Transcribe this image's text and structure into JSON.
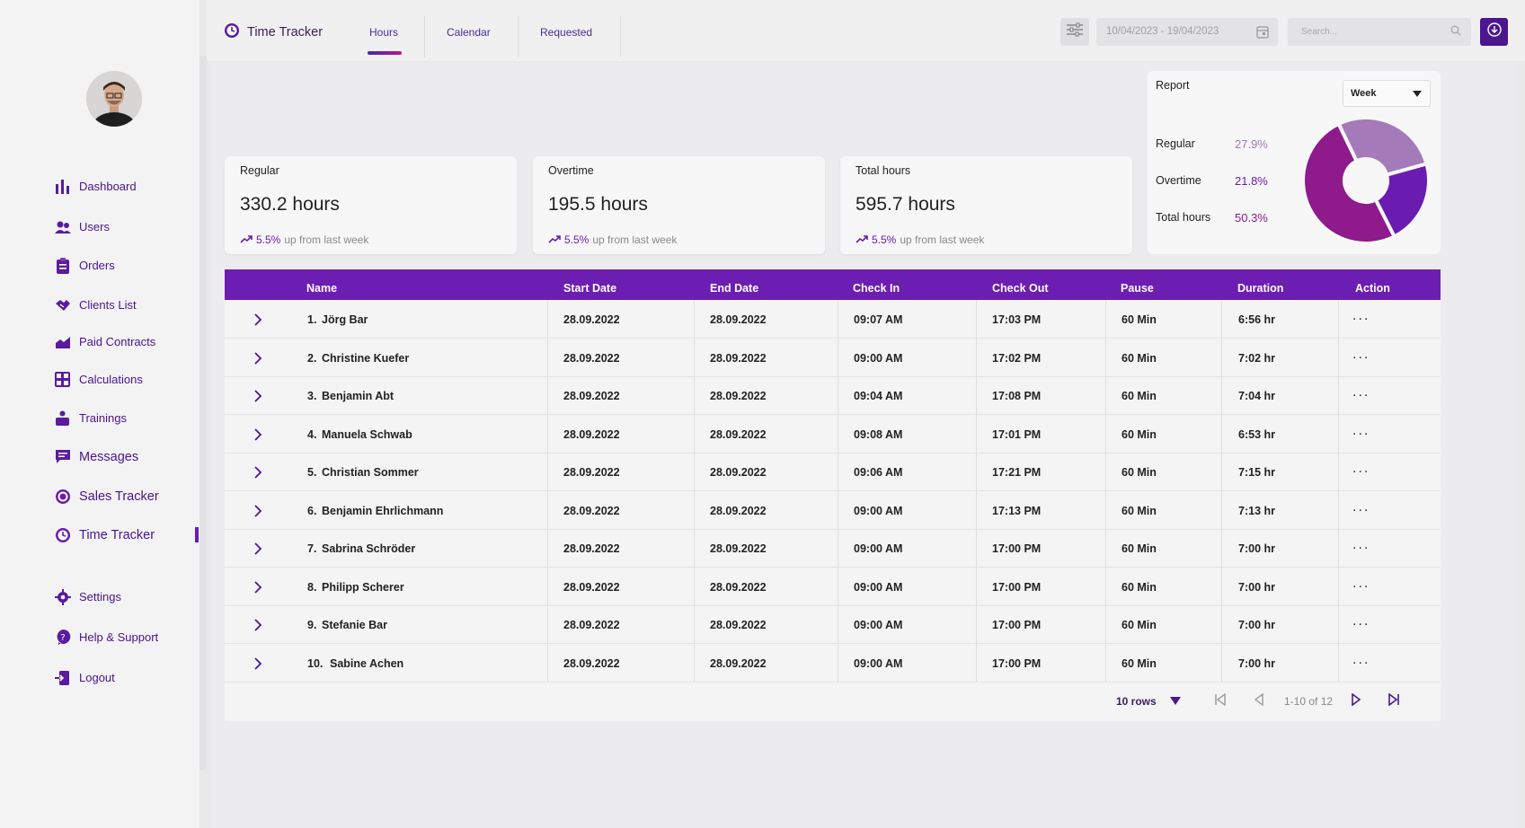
{
  "sidebar": {
    "items": [
      {
        "label": "Dashboard",
        "icon": "bar-chart-icon"
      },
      {
        "label": "Users",
        "icon": "users-icon"
      },
      {
        "label": "Orders",
        "icon": "clipboard-icon"
      },
      {
        "label": "Clients List",
        "icon": "handshake-icon"
      },
      {
        "label": "Paid Contracts",
        "icon": "growth-chart-icon"
      },
      {
        "label": "Calculations",
        "icon": "calculator-icon"
      },
      {
        "label": "Trainings",
        "icon": "trainings-icon"
      },
      {
        "label": "Messages",
        "icon": "message-icon"
      },
      {
        "label": "Sales Tracker",
        "icon": "target-icon"
      },
      {
        "label": "Time Tracker",
        "icon": "clock-icon"
      }
    ],
    "bottom": [
      {
        "label": "Settings",
        "icon": "gear-icon"
      },
      {
        "label": "Help & Support",
        "icon": "help-icon"
      },
      {
        "label": "Logout",
        "icon": "logout-icon"
      }
    ],
    "active": "Time Tracker"
  },
  "header": {
    "title": "Time Tracker",
    "tabs": [
      "Hours",
      "Calendar",
      "Requested"
    ],
    "active_tab": "Hours",
    "date_range": "10/04/2023 - 19/04/2023",
    "search_placeholder": "Search..."
  },
  "cards": [
    {
      "label": "Regular",
      "value": "330.2 hours",
      "trend_pct": "5.5%",
      "trend_text": "up from last week"
    },
    {
      "label": "Overtime",
      "value": "195.5 hours",
      "trend_pct": "5.5%",
      "trend_text": "up from last week"
    },
    {
      "label": "Total hours",
      "value": "595.7 hours",
      "trend_pct": "5.5%",
      "trend_text": "up from last week"
    }
  ],
  "report": {
    "title": "Report",
    "period": "Week",
    "legend": [
      {
        "label": "Regular",
        "value": "27.9%",
        "color": "#a57ab8"
      },
      {
        "label": "Overtime",
        "value": "21.8%",
        "color": "#6a1bb0"
      },
      {
        "label": "Total hours",
        "value": "50.3%",
        "color": "#8e1a8c"
      }
    ]
  },
  "chart_data": {
    "type": "pie",
    "categories": [
      "Regular",
      "Overtime",
      "Total hours"
    ],
    "values": [
      27.9,
      21.8,
      50.3
    ],
    "colors": [
      "#a57ab8",
      "#6a1bb0",
      "#8e1a8c"
    ]
  },
  "table": {
    "columns": [
      "Name",
      "Start Date",
      "End Date",
      "Check In",
      "Check Out",
      "Pause",
      "Duration",
      "Action"
    ],
    "rows": [
      {
        "num": "1.",
        "name": "Jörg Bar",
        "start": "28.09.2022",
        "end": "28.09.2022",
        "in": "09:07 AM",
        "out": "17:03 PM",
        "pause": "60 Min",
        "duration": "6:56 hr",
        "action": "..."
      },
      {
        "num": "2.",
        "name": "Christine Kuefer",
        "start": "28.09.2022",
        "end": "28.09.2022",
        "in": "09:00 AM",
        "out": "17:02 PM",
        "pause": "60 Min",
        "duration": "7:02 hr",
        "action": "..."
      },
      {
        "num": "3.",
        "name": "Benjamin Abt",
        "start": "28.09.2022",
        "end": "28.09.2022",
        "in": "09:04 AM",
        "out": "17:08 PM",
        "pause": "60 Min",
        "duration": "7:04 hr",
        "action": "..."
      },
      {
        "num": "4.",
        "name": "Manuela Schwab",
        "start": "28.09.2022",
        "end": "28.09.2022",
        "in": "09:08 AM",
        "out": "17:01 PM",
        "pause": "60 Min",
        "duration": "6:53 hr",
        "action": "..."
      },
      {
        "num": "5.",
        "name": "Christian Sommer",
        "start": "28.09.2022",
        "end": "28.09.2022",
        "in": "09:06 AM",
        "out": "17:21 PM",
        "pause": "60 Min",
        "duration": "7:15 hr",
        "action": "..."
      },
      {
        "num": "6.",
        "name": "Benjamin Ehrlichmann",
        "start": "28.09.2022",
        "end": "28.09.2022",
        "in": "09:00 AM",
        "out": "17:13 PM",
        "pause": "60 Min",
        "duration": "7:13 hr",
        "action": "..."
      },
      {
        "num": "7.",
        "name": "Sabrina Schröder",
        "start": "28.09.2022",
        "end": "28.09.2022",
        "in": "09:00 AM",
        "out": "17:00 PM",
        "pause": "60 Min",
        "duration": "7:00 hr",
        "action": "..."
      },
      {
        "num": "8.",
        "name": "Philipp Scherer",
        "start": "28.09.2022",
        "end": "28.09.2022",
        "in": "09:00 AM",
        "out": "17:00 PM",
        "pause": "60 Min",
        "duration": "7:00 hr",
        "action": "..."
      },
      {
        "num": "9.",
        "name": "Stefanie Bar",
        "start": "28.09.2022",
        "end": "28.09.2022",
        "in": "09:00 AM",
        "out": "17:00 PM",
        "pause": "60 Min",
        "duration": "7:00 hr",
        "action": "..."
      },
      {
        "num": "10.",
        "name": "Sabine Achen",
        "start": "28.09.2022",
        "end": "28.09.2022",
        "in": "09:00 AM",
        "out": "17:00 PM",
        "pause": "60 Min",
        "duration": "7:00 hr",
        "action": "..."
      }
    ]
  },
  "pager": {
    "rows_label": "10 rows",
    "range": "1-10 of 12"
  },
  "colors": {
    "accent": "#6c1db2",
    "brand_dark": "#4a1790"
  }
}
